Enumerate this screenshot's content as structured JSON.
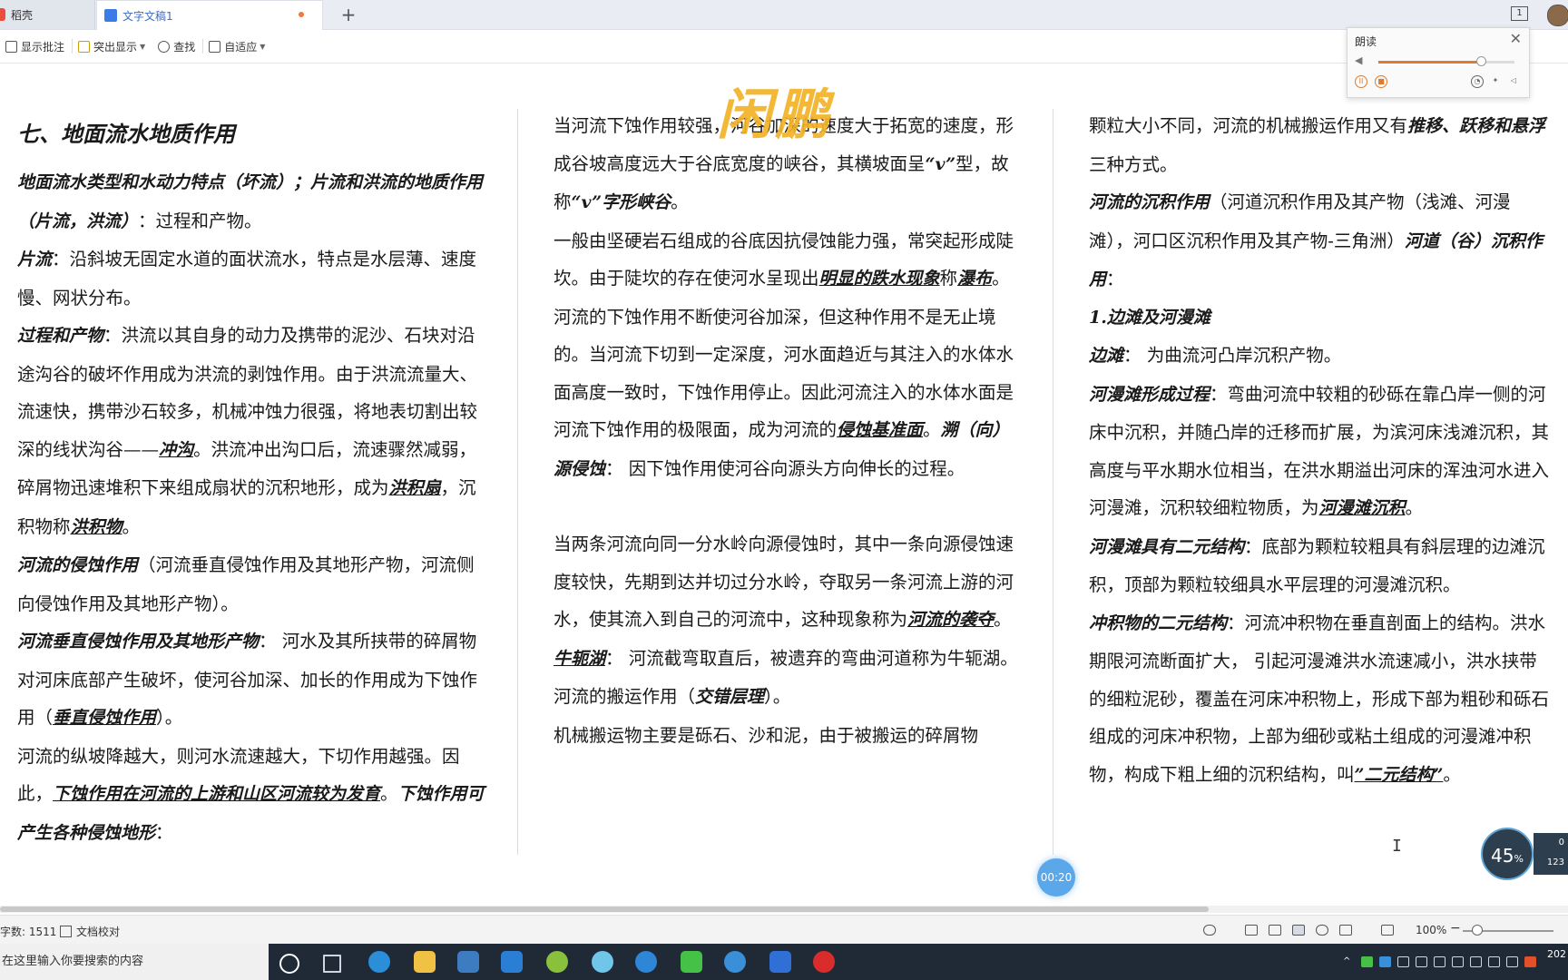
{
  "tabs": [
    {
      "label": "稻壳"
    },
    {
      "label": "文字文稿1"
    }
  ],
  "tabbar": {
    "new_tab": "+",
    "window_count": "1"
  },
  "toolbar": {
    "show_comments": "显示批注",
    "highlight": "突出显示",
    "find": "查找",
    "fit": "自适应"
  },
  "watermark": "闲鹏",
  "read_panel": {
    "title": "朗读",
    "close": "✕",
    "volume_level": 0.75
  },
  "document": {
    "col1": {
      "title": "七、地面流水地质作用",
      "p1_head": "地面流水类型和水动力特点（坏流）；片流和洪流的地质作用（片流，洪流）",
      "p1_tail": "：过程和产物。",
      "p2_head": "片流",
      "p2_tail": "：沿斜坡无固定水道的面状流水，特点是水层薄、速度慢、网状分布。",
      "p3_head": "过程和产物",
      "p3_a": "：洪流以其自身的动力及携带的泥沙、石块对沿途沟谷的破坏作用成为洪流的剥蚀作用。由于洪流流量大、流速快，携带沙石较多，机械冲蚀力很强，将地表切割出较深的线状沟谷——",
      "p3_u1": "冲沟",
      "p3_b": "。洪流冲出沟口后，流速骤然减弱，碎屑物迅速堆积下来组成扇状的沉积地形，成为",
      "p3_u2": "洪积扇",
      "p3_c": "，沉积物称",
      "p3_u3": "洪积物",
      "p3_d": "。",
      "p4_head": "河流的侵蚀作用",
      "p4_tail": "（河流垂直侵蚀作用及其地形产物，河流侧向侵蚀作用及其地形产物）。",
      "p5_head": "河流垂直侵蚀作用及其地形产物",
      "p5_a": "：  河水及其所挟带的碎屑物对河床底部产生破坏，使河谷加深、加长的作用成为下蚀作用（",
      "p5_u": "垂直侵蚀作用",
      "p5_b": "）。",
      "p6_a": "河流的纵坡降越大，则河水流速越大，下切作用越强。因此，",
      "p6_u": "下蚀作用在河流的上游和山区河流较为发育",
      "p6_b": "。",
      "p6_c": "下蚀作用可产生各种侵蚀地形",
      "p6_d": "："
    },
    "col2": {
      "p1_a": "当河流下蚀作用较强，河谷加深的速度大于拓宽的速度，形成谷坡高度远大于谷底宽度的峡谷，其横坡面呈",
      "p1_v": "“v”",
      "p1_b": "型，故称",
      "p1_c": "“v”字形峡谷",
      "p1_d": "。",
      "p2_a": "一般由坚硬岩石组成的谷底因抗侵蚀能力强，常突起形成陡坎。由于陡坎的存在使河水呈现出",
      "p2_b": "明显的跌水现象",
      "p2_c": "称",
      "p2_u": "瀑布",
      "p2_d": "。",
      "p3_a": "河流的下蚀作用不断使河谷加深，但这种作用不是无止境的。当河流下切到一定深度，河水面趋近与其注入的水体水面高度一致时，下蚀作用停止。因此河流注入的水体水面是河流下蚀作用的极限面，成为河流的",
      "p3_u": "侵蚀基准面",
      "p3_b": "。",
      "p3_c": "溯（向）源侵蚀",
      "p3_d": "：  因下蚀作用使河谷向源头方向伸长的过程。",
      "p4_a": "当两条河流向同一分水岭向源侵蚀时，其中一条向源侵蚀速度较快，先期到达并切过分水岭，夺取另一条河流上游的河水，使其流入到自己的河流中，这种现象称为",
      "p4_u": "河流的袭夺",
      "p4_b": "。",
      "p5_u": "牛轭湖",
      "p5_a": "：  河流截弯取直后，被遗弃的弯曲河道称为牛轭湖。河流的搬运作用（",
      "p5_b": "交错层理",
      "p5_c": "）。",
      "p6": "机械搬运物主要是砾石、沙和泥，由于被搬运的碎屑物"
    },
    "col3": {
      "p1_a": "颗粒大小不同，河流的机械搬运作用又有",
      "p1_b": "推移、跃移和悬浮",
      "p1_c": "三种方式。",
      "p2_head": "河流的沉积作用",
      "p2_a": "（河道沉积作用及其产物（浅滩、河漫滩），河口区沉积作用及其产物-三角洲）",
      "p2_b": "河道（谷）沉积作用",
      "p2_c": "：",
      "p3_head": "1.边滩及河漫滩",
      "p4_head": "边滩",
      "p4_tail": "：  为曲流河凸岸沉积产物。",
      "p5_head": "河漫滩形成过程",
      "p5_a": "：弯曲河流中较粗的砂砾在靠凸岸一侧的河床中沉积，并随凸岸的迁移而扩展，为滨河床浅滩沉积，其高度与平水期水位相当，在洪水期溢出河床的浑浊河水进入河漫滩，沉积较细粒物质，为",
      "p5_u": "河漫滩沉积",
      "p5_b": "。",
      "p6_head": "河漫滩具有二元结构",
      "p6_tail": "：底部为颗粒较粗具有斜层理的边滩沉积，顶部为颗粒较细具水平层理的河漫滩沉积。",
      "p7_head": "冲积物的二元结构",
      "p7_a": "：河流冲积物在垂直剖面上的结构。洪水期限河流断面扩大，  引起河漫滩洪水流速减小，洪水挟带的细粒泥砂，覆盖在河床冲积物上，形成下部为粗砂和砾石组成的河床冲积物，上部为细砂或粘土组成的河漫滩冲积物，构成下粗上细的沉积结构，叫",
      "p7_u": "”二元结构”",
      "p7_b": "。"
    }
  },
  "overlays": {
    "timer": "00:20",
    "bubble_value": "45",
    "bubble_unit": "%",
    "net_up": "0",
    "net_down": "123",
    "cursor": "I"
  },
  "statusbar": {
    "word_count": "字数: 1511",
    "proofread": "文档校对",
    "zoom": "100%"
  },
  "taskbar": {
    "search_placeholder": "在这里输入你要搜索的内容",
    "clock": "202"
  },
  "colors": {
    "accent": "#3b7be8",
    "watermark": "#f3b227",
    "timer": "#5aa7ea",
    "taskbar": "#1f2a36"
  }
}
